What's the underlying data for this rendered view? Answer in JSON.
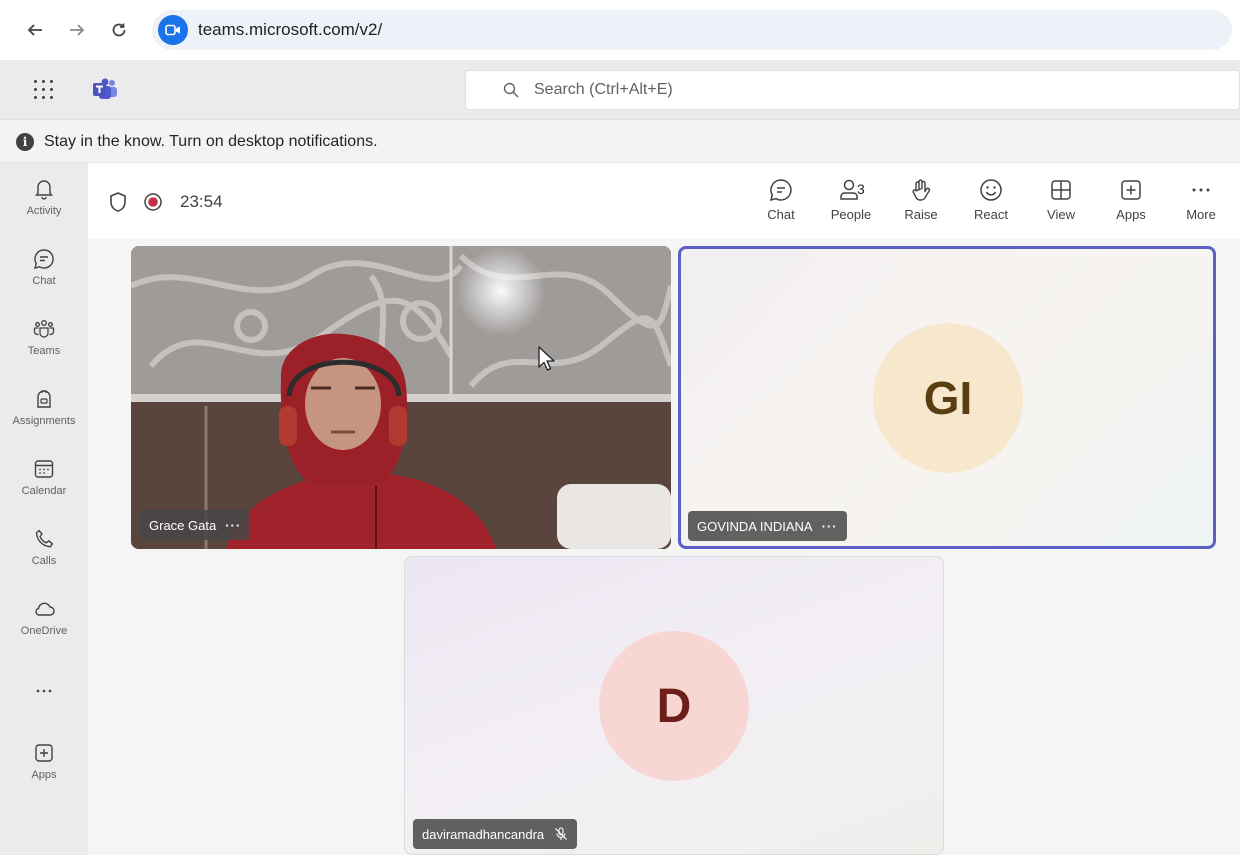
{
  "browser": {
    "url": "teams.microsoft.com/v2/"
  },
  "header": {
    "search_placeholder": "Search (Ctrl+Alt+E)"
  },
  "notification": {
    "text": "Stay in the know. Turn on desktop notifications."
  },
  "left_rail": {
    "items": [
      {
        "label": "Activity",
        "icon": "bell-icon"
      },
      {
        "label": "Chat",
        "icon": "chat-icon"
      },
      {
        "label": "Teams",
        "icon": "teams-icon"
      },
      {
        "label": "Assignments",
        "icon": "assignments-icon"
      },
      {
        "label": "Calendar",
        "icon": "calendar-icon"
      },
      {
        "label": "Calls",
        "icon": "phone-icon"
      },
      {
        "label": "OneDrive",
        "icon": "cloud-icon"
      },
      {
        "label": "Apps",
        "icon": "add-apps-icon"
      }
    ]
  },
  "meeting": {
    "timer": "23:54",
    "people_count": "3",
    "tools": [
      {
        "label": "Chat"
      },
      {
        "label": "People"
      },
      {
        "label": "Raise"
      },
      {
        "label": "React"
      },
      {
        "label": "View"
      },
      {
        "label": "Apps"
      },
      {
        "label": "More"
      }
    ]
  },
  "participants": [
    {
      "name": "Grace Gata",
      "initials": "",
      "video": true
    },
    {
      "name": "GOVINDA INDIANA",
      "initials": "GI",
      "video": false,
      "speaking": true
    },
    {
      "name": "daviramadhancandra",
      "initials": "D",
      "video": false,
      "muted": true
    }
  ],
  "colors": {
    "accent": "#5b5fc7",
    "recording": "#c4314b",
    "browser_icon": "#1a73e8"
  }
}
